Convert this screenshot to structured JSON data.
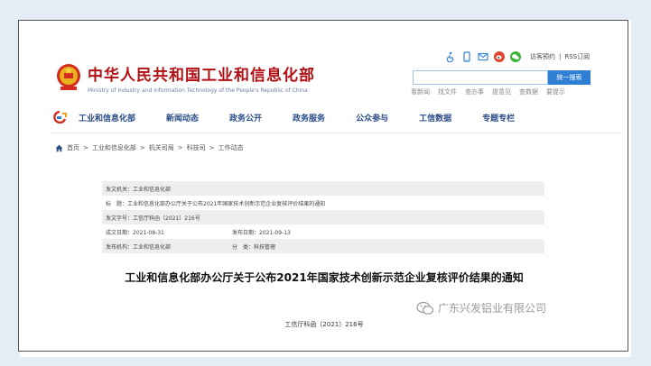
{
  "site": {
    "title_cn": "中华人民共和国工业和信息化部",
    "title_en": "Ministry of Industry and Information Technology of the People's Republic of China"
  },
  "top_links": {
    "visit": "访客预约",
    "separator": "|",
    "rss": "RSS订阅"
  },
  "search": {
    "placeholder": "",
    "button_label": "统一搜索"
  },
  "quick_links": [
    "看新闻",
    "找文件",
    "查办事",
    "提意见",
    "查数据",
    "要提示"
  ],
  "nav": [
    "工业和信息化部",
    "新闻动态",
    "政务公开",
    "政务服务",
    "公众参与",
    "工信数据",
    "专题专栏"
  ],
  "breadcrumb": [
    "首页",
    ">",
    "工业和信息化部",
    ">",
    "机关司局",
    ">",
    "科技司",
    ">",
    "工作动态"
  ],
  "meta": {
    "issuer": "发文机关：工业和信息化部",
    "subject": "标　题：工业和信息化部办公厅关于公布2021年国家技术创新示范企业复核评价结果的通知",
    "doc_no": "发文字号：工信厅科函〔2021〕216号",
    "created": "成文日期：2021-08-31",
    "published": "发布日期：2021-09-13",
    "agency": "发布机构：工业和信息化部",
    "category": "分　类：科技管理"
  },
  "document": {
    "title": "工业和信息化部办公厅关于公布2021年国家技术创新示范企业复核评价结果的通知",
    "number": "工信厅科函〔2021〕216号"
  },
  "watermark": {
    "text": "广东兴发铝业有限公司"
  },
  "icons": {
    "accessibility": "accessibility-icon",
    "mobile": "mobile-icon",
    "mail": "mail-icon",
    "weibo": "weibo-icon",
    "wechat": "wechat-icon",
    "home": "home-icon"
  },
  "colors": {
    "title_red": "#b20f14",
    "nav_blue": "#2a4c86",
    "search_blue": "#2f7fd5",
    "frame": "#e4ecf6"
  }
}
